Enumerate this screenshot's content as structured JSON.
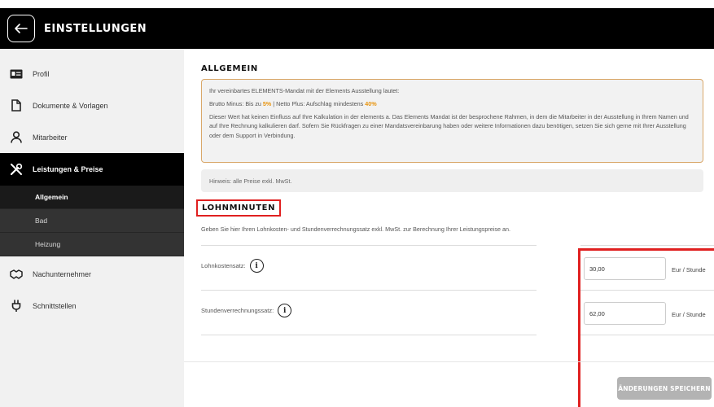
{
  "header": {
    "title": "EINSTELLUNGEN"
  },
  "sidebar": {
    "items": [
      {
        "label": "Profil",
        "icon": "id-card-icon"
      },
      {
        "label": "Dokumente & Vorlagen",
        "icon": "document-icon"
      },
      {
        "label": "Mitarbeiter",
        "icon": "user-icon"
      },
      {
        "label": "Leistungen & Preise",
        "icon": "tools-icon",
        "active": true
      },
      {
        "label": "Nachunternehmer",
        "icon": "handshake-icon"
      },
      {
        "label": "Schnittstellen",
        "icon": "plug-icon"
      }
    ],
    "subitems": [
      {
        "label": "Allgemein",
        "active": true
      },
      {
        "label": "Bad"
      },
      {
        "label": "Heizung"
      }
    ]
  },
  "main": {
    "section_title": "ALLGEMEIN",
    "info": {
      "line1": "Ihr vereinbartes ELEMENTS-Mandat mit der Elements Ausstellung lautet:",
      "brutto_prefix": "Brutto Minus: Bis zu ",
      "brutto_value": "5%",
      "netto_prefix": " | Netto Plus: Aufschlag mindestens ",
      "netto_value": "40%",
      "paragraph": "Dieser Wert hat keinen Einfluss auf Ihre Kalkulation in der elements a. Das Elements Mandat ist der besprochene Rahmen, in dem die Mitarbeiter in der Ausstellung in Ihrem Namen und auf Ihre Rechnung kalkulieren darf. Sofern Sie Rückfragen zu einer Mandatsvereinbarung haben oder weitere Informationen dazu benötigen, setzen Sie sich gerne mit Ihrer Ausstellung oder dem Support in Verbindung."
    },
    "hint": "Hinweis: alle Preise exkl. MwSt.",
    "lohn_title": "LOHNMINUTEN",
    "lohn_desc": "Geben Sie hier Ihren Lohnkosten- und Stundenverrechnungssatz exkl. MwSt. zur Berechnung Ihrer Leistungspreise an.",
    "rows": [
      {
        "label": "Lohnkostensatz:",
        "value": "30,00",
        "unit": "Eur / Stunde"
      },
      {
        "label": "Stundenverrechnungssatz:",
        "value": "62,00",
        "unit": "Eur / Stunde"
      }
    ],
    "info_glyph": "i",
    "save_label": "ÄNDERUNGEN SPEICHERN"
  },
  "colors": {
    "accent_orange": "#e89510",
    "highlight_red": "#e02020",
    "sidebar_active": "#000000"
  }
}
